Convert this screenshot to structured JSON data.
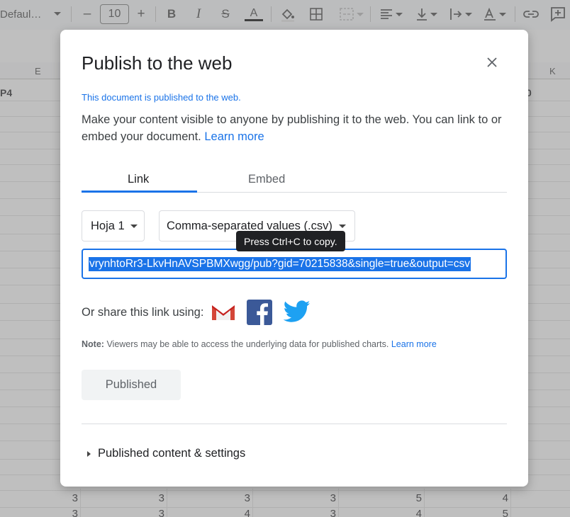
{
  "toolbar": {
    "font_name": "Defaul…",
    "font_size": "10",
    "minus": "–",
    "plus": "+",
    "bold": "B",
    "italic": "I",
    "strike": "S",
    "text_color": "A"
  },
  "sheet": {
    "column_labels": {
      "e": "E",
      "k": "K"
    },
    "row1_left": "P4",
    "row1_right": "0",
    "bottom_row1": [
      "3",
      "3",
      "3",
      "3",
      "5",
      "4"
    ],
    "bottom_row2": [
      "3",
      "3",
      "4",
      "3",
      "4",
      "5"
    ]
  },
  "dialog": {
    "title": "Publish to the web",
    "status": "This document is published to the web.",
    "description": "Make your content visible to anyone by publishing it to the web. You can link to or embed your document.",
    "learn_more": "Learn more",
    "tabs": [
      {
        "label": "Link",
        "active": true
      },
      {
        "label": "Embed",
        "active": false
      }
    ],
    "sheet_select": "Hoja 1",
    "format_select": "Comma-separated values (.csv)",
    "tooltip": "Press Ctrl+C to copy.",
    "url": "vrynhtoRr3-LkvHnAVSPBMXwgg/pub?gid=70215838&single=true&output=csv",
    "share_label": "Or share this link using:",
    "share_icons": [
      "gmail-icon",
      "facebook-icon",
      "twitter-icon"
    ],
    "note_label": "Note:",
    "note_text": "Viewers may be able to access the underlying data for published charts.",
    "note_link": "Learn more",
    "published_button": "Published",
    "settings_label": "Published content & settings"
  },
  "colors": {
    "accent": "#1a73e8",
    "overlay": "rgba(128,128,128,0.5)",
    "gmail_red": "#d44638",
    "facebook_blue": "#3b5998",
    "twitter_blue": "#1da1f2"
  }
}
